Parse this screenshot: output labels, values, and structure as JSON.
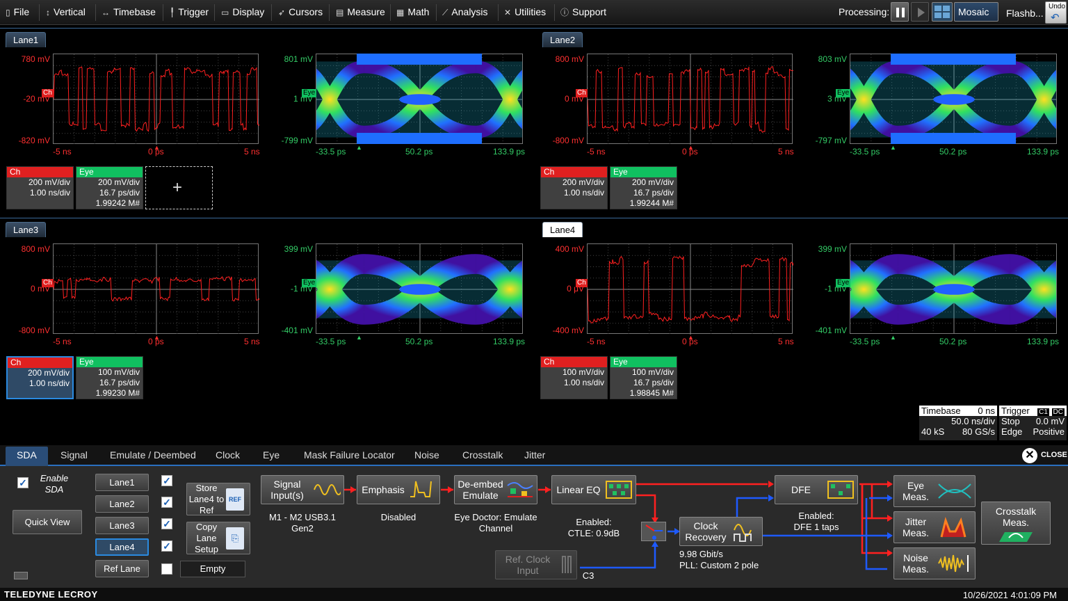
{
  "menubar": {
    "items": [
      {
        "label": "File",
        "icon": "file-icon"
      },
      {
        "label": "Vertical",
        "icon": "vertical-arrows-icon"
      },
      {
        "label": "Timebase",
        "icon": "horizontal-arrows-icon"
      },
      {
        "label": "Trigger",
        "icon": "trigger-icon"
      },
      {
        "label": "Display",
        "icon": "display-icon"
      },
      {
        "label": "Cursors",
        "icon": "cursor-icon"
      },
      {
        "label": "Measure",
        "icon": "measure-icon"
      },
      {
        "label": "Math",
        "icon": "calculator-icon"
      },
      {
        "label": "Analysis",
        "icon": "analysis-chart-icon"
      },
      {
        "label": "Utilities",
        "icon": "wrench-icon"
      },
      {
        "label": "Support",
        "icon": "info-icon"
      }
    ],
    "processing_label": "Processing:",
    "display_mode": "Mosaic",
    "flashback_label": "Flashb...",
    "undo_label": "Undo"
  },
  "lanes": [
    {
      "tab": "Lane1",
      "active": false,
      "ch": {
        "ytop": "780 mV",
        "ymid": "-20 mV",
        "ybot": "-820 mV",
        "xl": "-5 ns",
        "xm": "0 ps",
        "xr": "5 ns"
      },
      "eye": {
        "ytop": "801 mV",
        "ymid": "1 mV",
        "ybot": "-799 mV",
        "xl": "-33.5 ps",
        "xm": "50.2 ps",
        "xr": "133.9 ps"
      },
      "desc_ch": {
        "hd": "Ch",
        "l1": "200 mV/div",
        "l2": "1.00 ns/div"
      },
      "desc_eye": {
        "hd": "Eye",
        "l1": "200 mV/div",
        "l2": "16.7 ps/div",
        "l3": "1.99242 M#"
      }
    },
    {
      "tab": "Lane2",
      "active": false,
      "ch": {
        "ytop": "800 mV",
        "ymid": "0 mV",
        "ybot": "-800 mV",
        "xl": "-5 ns",
        "xm": "0 ps",
        "xr": "5 ns"
      },
      "eye": {
        "ytop": "803 mV",
        "ymid": "3 mV",
        "ybot": "-797 mV",
        "xl": "-33.5 ps",
        "xm": "50.2 ps",
        "xr": "133.9 ps"
      },
      "desc_ch": {
        "hd": "Ch",
        "l1": "200 mV/div",
        "l2": "1.00 ns/div"
      },
      "desc_eye": {
        "hd": "Eye",
        "l1": "200 mV/div",
        "l2": "16.7 ps/div",
        "l3": "1.99244 M#"
      }
    },
    {
      "tab": "Lane3",
      "active": false,
      "ch": {
        "ytop": "800 mV",
        "ymid": "0 mV",
        "ybot": "-800 mV",
        "xl": "-5 ns",
        "xm": "0 ps",
        "xr": "5 ns"
      },
      "eye": {
        "ytop": "399 mV",
        "ymid": "-1 mV",
        "ybot": "-401 mV",
        "xl": "-33.5 ps",
        "xm": "50.2 ps",
        "xr": "133.9 ps"
      },
      "desc_ch": {
        "hd": "Ch",
        "l1": "200 mV/div",
        "l2": "1.00 ns/div"
      },
      "desc_eye": {
        "hd": "Eye",
        "l1": "100 mV/div",
        "l2": "16.7 ps/div",
        "l3": "1.99230 M#"
      }
    },
    {
      "tab": "Lane4",
      "active": true,
      "ch": {
        "ytop": "400 mV",
        "ymid": "0 μV",
        "ybot": "-400 mV",
        "xl": "-5 ns",
        "xm": "0 ps",
        "xr": "5 ns"
      },
      "eye": {
        "ytop": "399 mV",
        "ymid": "-1 mV",
        "ybot": "-401 mV",
        "xl": "-33.5 ps",
        "xm": "50.2 ps",
        "xr": "133.9 ps"
      },
      "desc_ch": {
        "hd": "Ch",
        "l1": "100 mV/div",
        "l2": "1.00 ns/div"
      },
      "desc_eye": {
        "hd": "Eye",
        "l1": "100 mV/div",
        "l2": "16.7 ps/div",
        "l3": "1.98845 M#"
      }
    }
  ],
  "chip_ch": "Ch",
  "chip_eye": "Eye",
  "timebase": {
    "hd": "Timebase",
    "delay": "0 ns",
    "div": "50.0 ns/div",
    "samples": "40 kS",
    "rate": "80 GS/s"
  },
  "trigger": {
    "hd": "Trigger",
    "src": "C1",
    "cpl": "DC",
    "mode": "Stop",
    "level": "0.0 mV",
    "type": "Edge",
    "slope": "Positive"
  },
  "panel": {
    "tabs": [
      "SDA",
      "Signal",
      "Emulate / Deembed",
      "Clock",
      "Eye",
      "Mask Failure Locator",
      "Noise",
      "Crosstalk",
      "Jitter"
    ],
    "close_label": "CLOSE",
    "enable_sda": "Enable SDA",
    "quick_view": "Quick View",
    "lane_buttons": [
      "Lane1",
      "Lane2",
      "Lane3",
      "Lane4",
      "Ref Lane"
    ],
    "store_ref": "Store Lane4 to Ref",
    "copy_setup": "Copy Lane Setup",
    "empty_label": "Empty",
    "blocks": {
      "signal": "Signal Input(s)",
      "signal_sub": "M1 - M2 USB3.1 Gen2",
      "emphasis": "Emphasis",
      "emphasis_sub": "Disabled",
      "deembed": "De-embed Emulate",
      "deembed_sub": "Eye Doctor: Emulate Channel",
      "lineq": "Linear EQ",
      "lineq_sub1": "Enabled:",
      "lineq_sub2": "CTLE: 0.9dB",
      "refclk": "Ref. Clock Input",
      "refclk_sub": "C3",
      "clock": "Clock Recovery",
      "clock_sub1": "9.98 Gbit/s",
      "clock_sub2": "PLL: Custom 2 pole",
      "dfe": "DFE",
      "dfe_sub1": "Enabled:",
      "dfe_sub2": "DFE 1 taps",
      "eyemeas": "Eye Meas.",
      "jitter": "Jitter Meas.",
      "noise": "Noise Meas.",
      "crosstalk": "Crosstalk Meas."
    }
  },
  "footer": {
    "brand": "TELEDYNE LECROY",
    "datetime": "10/26/2021 4:01:09 PM"
  },
  "colors": {
    "trace": "#ff2020",
    "marker": "#1e6eff",
    "accent": "#2a70c0",
    "ch": "#e02020",
    "eye": "#10c060"
  }
}
